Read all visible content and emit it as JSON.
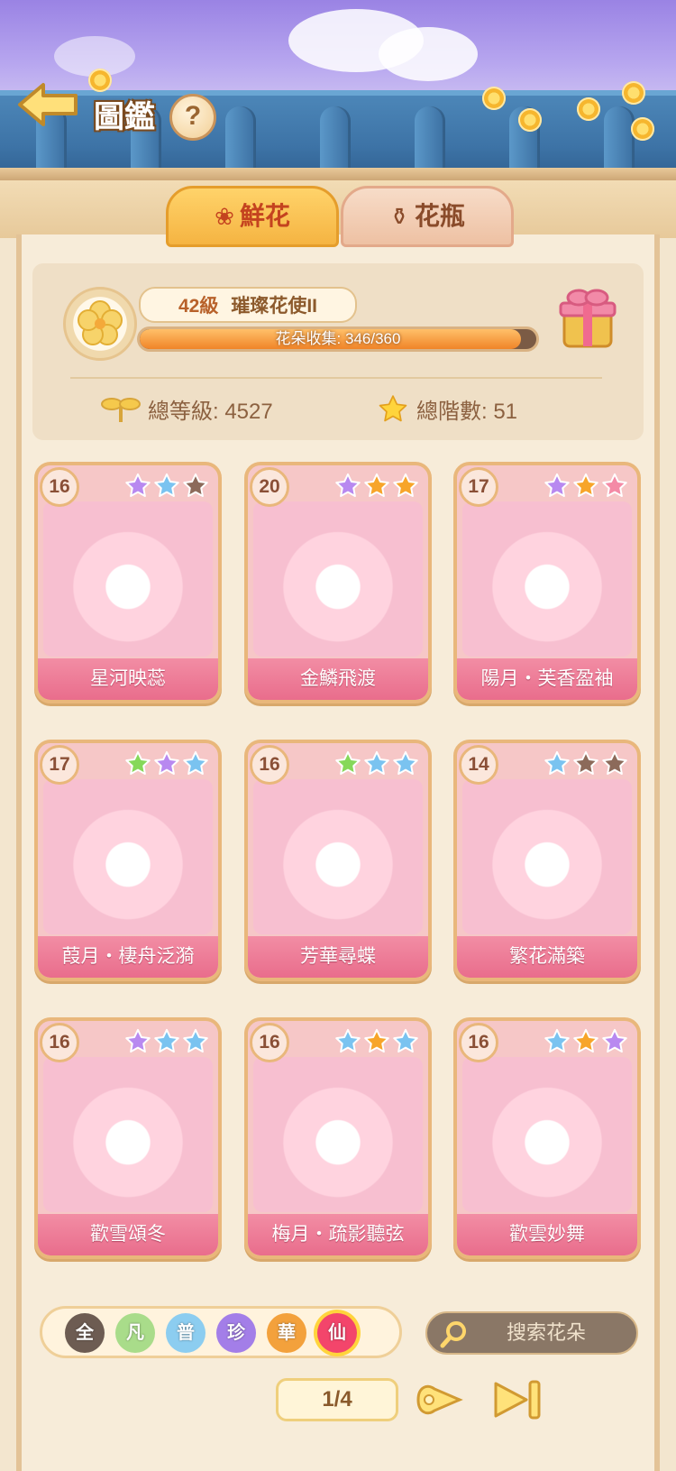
{
  "header": {
    "title": "圖鑑",
    "help_label": "?"
  },
  "tabs": [
    {
      "label": "鮮花",
      "icon": "rose-icon",
      "active": true
    },
    {
      "label": "花瓶",
      "icon": "vase-icon",
      "active": false
    }
  ],
  "summary": {
    "level_label": "42級",
    "rank_label": "璀璨花使II",
    "collection_label": "花朵收集: 346/360",
    "collection_progress": 0.961,
    "total_level_label": "總等級: 4527",
    "total_stars_label": "總階數: 51"
  },
  "cards": [
    {
      "level": "16",
      "name": "星河映蕊",
      "stars": [
        "purple",
        "blue",
        "brown"
      ]
    },
    {
      "level": "20",
      "name": "金鱗飛渡",
      "stars": [
        "purple",
        "orange",
        "orange"
      ]
    },
    {
      "level": "17",
      "name": "陽月・芙香盈袖",
      "stars": [
        "purple",
        "orange",
        "pink"
      ]
    },
    {
      "level": "17",
      "name": "葭月・棲舟泛漪",
      "stars": [
        "green",
        "purple",
        "blue"
      ]
    },
    {
      "level": "16",
      "name": "芳華尋蝶",
      "stars": [
        "green",
        "blue",
        "blue"
      ]
    },
    {
      "level": "14",
      "name": "繁花滿築",
      "stars": [
        "blue",
        "brown",
        "brown"
      ]
    },
    {
      "level": "16",
      "name": "歡雪頌冬",
      "stars": [
        "purple",
        "blue",
        "blue"
      ]
    },
    {
      "level": "16",
      "name": "梅月・疏影聽弦",
      "stars": [
        "blue",
        "orange",
        "blue"
      ]
    },
    {
      "level": "16",
      "name": "歡雲妙舞",
      "stars": [
        "blue",
        "orange",
        "purple"
      ]
    }
  ],
  "filters": [
    {
      "label": "全",
      "color": "#6d5c52",
      "active": false
    },
    {
      "label": "凡",
      "color": "#a9dc8a",
      "active": false
    },
    {
      "label": "普",
      "color": "#8ccdf0",
      "active": false
    },
    {
      "label": "珍",
      "color": "#a37ee8",
      "active": false
    },
    {
      "label": "華",
      "color": "#f3a13c",
      "active": false
    },
    {
      "label": "仙",
      "color": "#f3456b",
      "active": true
    }
  ],
  "search": {
    "placeholder": "搜索花朵"
  },
  "pager": {
    "indicator": "1/4"
  },
  "colors": {
    "star_purple": "#b889f0",
    "star_blue": "#7ac3f0",
    "star_orange": "#f7a52a",
    "star_pink": "#f48aa6",
    "star_green": "#86d85a",
    "star_brown": "#8c6a5a"
  }
}
